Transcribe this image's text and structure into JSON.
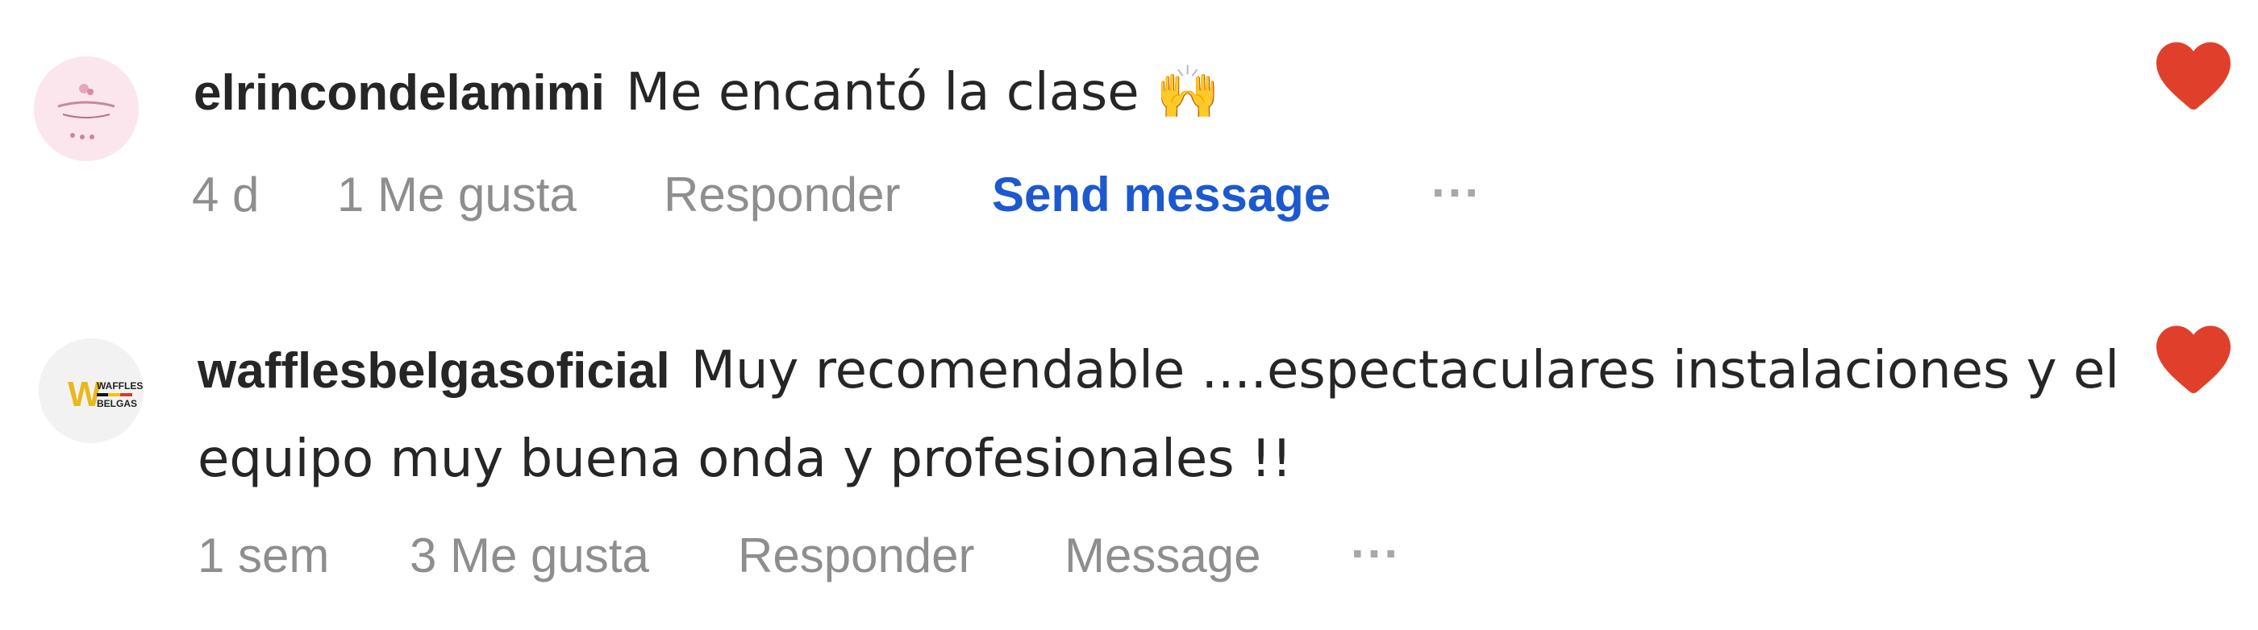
{
  "comments": [
    {
      "username": "elrincondelamimi",
      "text": "Me encantó la clase 🙌",
      "time": "4 d",
      "likes": "1 Me gusta",
      "reply": "Responder",
      "message": "Send message",
      "more": "...",
      "liked": true,
      "heart_color": "#ed4956"
    },
    {
      "username": "wafflesbelgasoficial",
      "text_line1": "Muy recomendable ....espectaculares instalaciones y el",
      "text_line2": "equipo muy buena onda y profesionales !!",
      "time": "1 sem",
      "likes": "3 Me gusta",
      "reply": "Responder",
      "message": "Message",
      "more": "...",
      "liked": true,
      "heart_color": "#ed4956"
    }
  ]
}
